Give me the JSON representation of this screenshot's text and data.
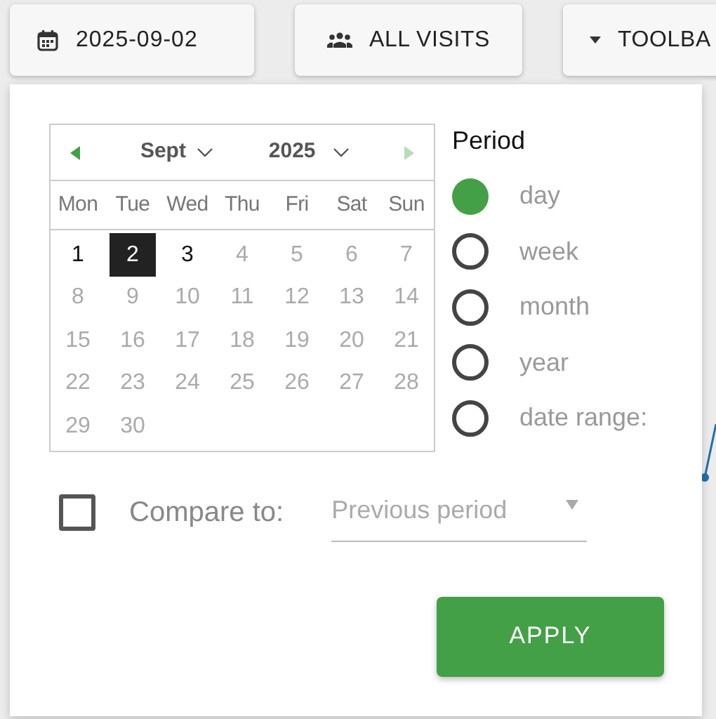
{
  "toolbar": {
    "buttons": [
      {
        "kind": "date",
        "label": "2025-09-02"
      },
      {
        "kind": "segment",
        "label": "ALL VISITS"
      },
      {
        "kind": "menu",
        "label": "TOOLBA"
      }
    ]
  },
  "calendar": {
    "prev_disabled": false,
    "next_disabled": true,
    "month": "Sept",
    "year": "2025",
    "weekdays": [
      "Mon",
      "Tue",
      "Wed",
      "Thu",
      "Fri",
      "Sat",
      "Sun"
    ],
    "weeks": [
      [
        {
          "day": "1",
          "disabled": false,
          "selected": false
        },
        {
          "day": "2",
          "disabled": false,
          "selected": true
        },
        {
          "day": "3",
          "disabled": false,
          "selected": false
        },
        {
          "day": "4",
          "disabled": true,
          "selected": false
        },
        {
          "day": "5",
          "disabled": true,
          "selected": false
        },
        {
          "day": "6",
          "disabled": true,
          "selected": false
        },
        {
          "day": "7",
          "disabled": true,
          "selected": false
        }
      ],
      [
        {
          "day": "8",
          "disabled": true,
          "selected": false
        },
        {
          "day": "9",
          "disabled": true,
          "selected": false
        },
        {
          "day": "10",
          "disabled": true,
          "selected": false
        },
        {
          "day": "11",
          "disabled": true,
          "selected": false
        },
        {
          "day": "12",
          "disabled": true,
          "selected": false
        },
        {
          "day": "13",
          "disabled": true,
          "selected": false
        },
        {
          "day": "14",
          "disabled": true,
          "selected": false
        }
      ],
      [
        {
          "day": "15",
          "disabled": true,
          "selected": false
        },
        {
          "day": "16",
          "disabled": true,
          "selected": false
        },
        {
          "day": "17",
          "disabled": true,
          "selected": false
        },
        {
          "day": "18",
          "disabled": true,
          "selected": false
        },
        {
          "day": "19",
          "disabled": true,
          "selected": false
        },
        {
          "day": "20",
          "disabled": true,
          "selected": false
        },
        {
          "day": "21",
          "disabled": true,
          "selected": false
        }
      ],
      [
        {
          "day": "22",
          "disabled": true,
          "selected": false
        },
        {
          "day": "23",
          "disabled": true,
          "selected": false
        },
        {
          "day": "24",
          "disabled": true,
          "selected": false
        },
        {
          "day": "25",
          "disabled": true,
          "selected": false
        },
        {
          "day": "26",
          "disabled": true,
          "selected": false
        },
        {
          "day": "27",
          "disabled": true,
          "selected": false
        },
        {
          "day": "28",
          "disabled": true,
          "selected": false
        }
      ],
      [
        {
          "day": "29",
          "disabled": true,
          "selected": false
        },
        {
          "day": "30",
          "disabled": true,
          "selected": false
        }
      ]
    ]
  },
  "period": {
    "title": "Period",
    "options": [
      {
        "label": "day",
        "selected": true
      },
      {
        "label": "week",
        "selected": false
      },
      {
        "label": "month",
        "selected": false
      },
      {
        "label": "year",
        "selected": false
      },
      {
        "label": "date range:",
        "selected": false
      }
    ]
  },
  "compare": {
    "checked": false,
    "label": "Compare to:",
    "value": "Previous period"
  },
  "apply_button": "APPLY"
}
